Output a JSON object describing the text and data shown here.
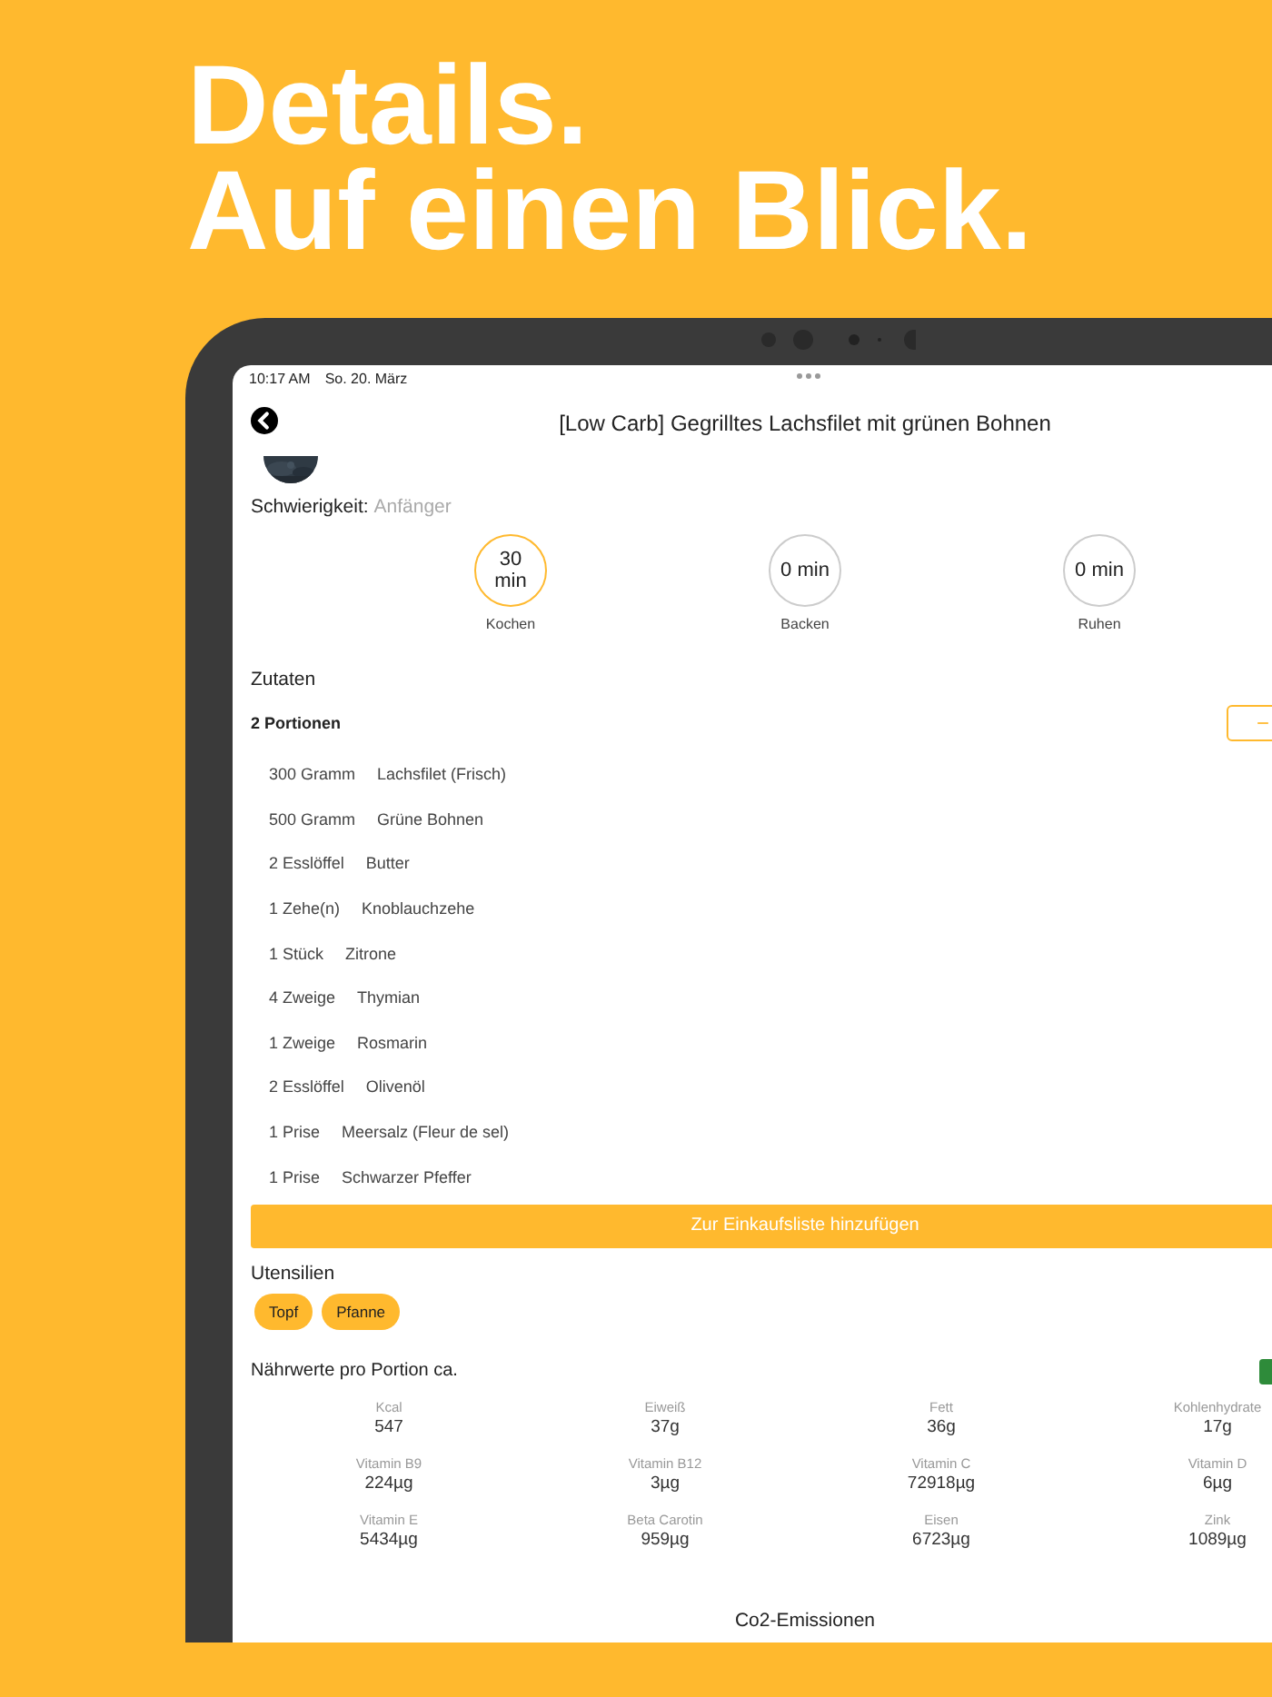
{
  "headline": [
    "Details.",
    "Auf einen Blick."
  ],
  "status_bar": {
    "time": "10:17 AM",
    "date": "So. 20. März"
  },
  "header": {
    "title": "[Low Carb] Gegrilltes Lachsfilet mit grünen Bohnen"
  },
  "difficulty": {
    "label": "Schwierigkeit:",
    "value": "Anfänger"
  },
  "times": [
    {
      "value": "30 min",
      "label": "Kochen",
      "selected": true
    },
    {
      "value": "0 min",
      "label": "Backen",
      "selected": false
    },
    {
      "value": "0 min",
      "label": "Ruhen",
      "selected": false
    }
  ],
  "ingredients": {
    "title": "Zutaten",
    "portions": "2 Portionen",
    "minus": "−",
    "items": [
      {
        "amount": "300 Gramm",
        "name": "Lachsfilet (Frisch)"
      },
      {
        "amount": "500 Gramm",
        "name": "Grüne Bohnen"
      },
      {
        "amount": "2 Esslöffel",
        "name": "Butter"
      },
      {
        "amount": "1 Zehe(n)",
        "name": "Knoblauchzehe"
      },
      {
        "amount": "1 Stück",
        "name": "Zitrone"
      },
      {
        "amount": "4 Zweige",
        "name": "Thymian"
      },
      {
        "amount": "1 Zweige",
        "name": "Rosmarin"
      },
      {
        "amount": "2 Esslöffel",
        "name": "Olivenöl"
      },
      {
        "amount": "1 Prise",
        "name": "Meersalz (Fleur de sel)"
      },
      {
        "amount": "1 Prise",
        "name": "Schwarzer Pfeffer"
      }
    ]
  },
  "shopping_button": "Zur Einkaufsliste hinzufügen",
  "utensils": {
    "title": "Utensilien",
    "items": [
      "Topf",
      "Pfanne"
    ]
  },
  "nutrition": {
    "title": "Nährwerte pro Portion ca.",
    "items": [
      {
        "label": "Kcal",
        "value": "547"
      },
      {
        "label": "Eiweiß",
        "value": "37g"
      },
      {
        "label": "Fett",
        "value": "36g"
      },
      {
        "label": "Kohlenhydrate",
        "value": "17g"
      },
      {
        "label": "Vitamin B9",
        "value": "224µg"
      },
      {
        "label": "Vitamin B12",
        "value": "3µg"
      },
      {
        "label": "Vitamin C",
        "value": "72918µg"
      },
      {
        "label": "Vitamin D",
        "value": "6µg"
      },
      {
        "label": "Vitamin E",
        "value": "5434µg"
      },
      {
        "label": "Beta Carotin",
        "value": "959µg"
      },
      {
        "label": "Eisen",
        "value": "6723µg"
      },
      {
        "label": "Zink",
        "value": "1089µg"
      }
    ]
  },
  "co2": {
    "title": "Co2-Emissionen"
  }
}
